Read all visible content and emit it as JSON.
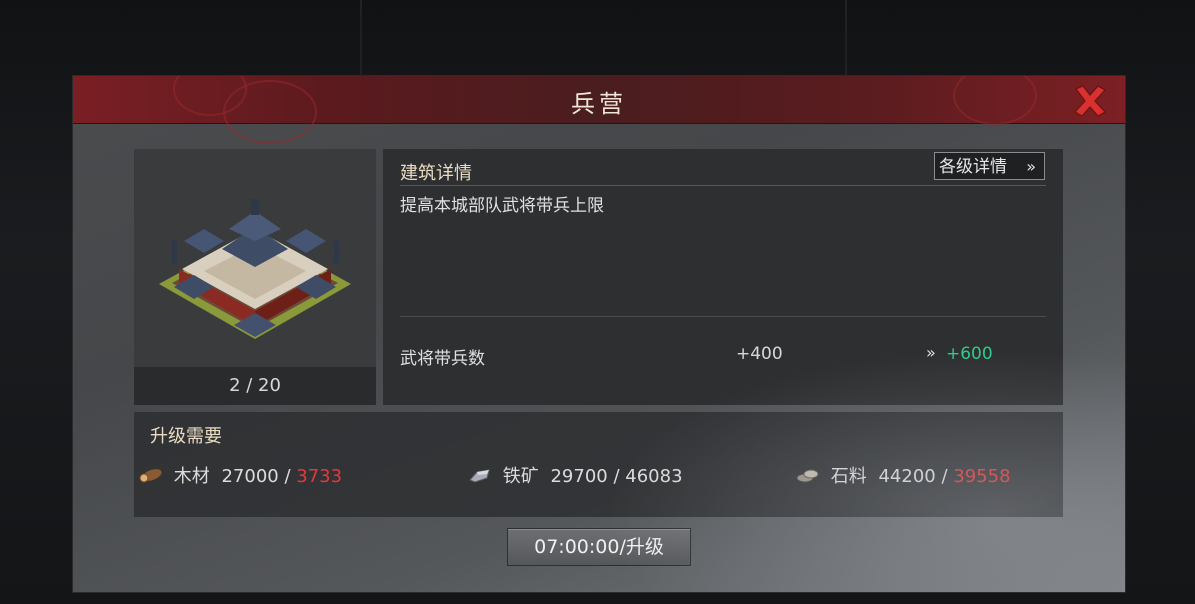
{
  "dialog": {
    "title": "兵营",
    "close_icon": "close-x-icon",
    "accent_color": "#d93030"
  },
  "building": {
    "level": "2 / 20",
    "image_icon": "barracks-building-icon"
  },
  "details": {
    "heading": "建筑详情",
    "levels_button": "各级详情",
    "levels_button_chevron": "»",
    "description": "提高本城部队武将带兵上限",
    "stat": {
      "label": "武将带兵数",
      "current": "+400",
      "arrow": "»",
      "next": "+600",
      "next_color": "#2ecc8a"
    }
  },
  "requirements": {
    "heading": "升级需要",
    "resources": [
      {
        "name": "木材",
        "need": "27000",
        "have": "3733",
        "icon": "wood-log-icon",
        "sufficient": false
      },
      {
        "name": "铁矿",
        "need": "29700",
        "have": "46083",
        "icon": "iron-ore-icon",
        "sufficient": true
      },
      {
        "name": "石料",
        "need": "44200",
        "have": "39558",
        "icon": "stone-icon",
        "sufficient": false
      }
    ],
    "insufficient_color": "#e23a3a"
  },
  "upgrade": {
    "label": "07:00:00/升级"
  }
}
